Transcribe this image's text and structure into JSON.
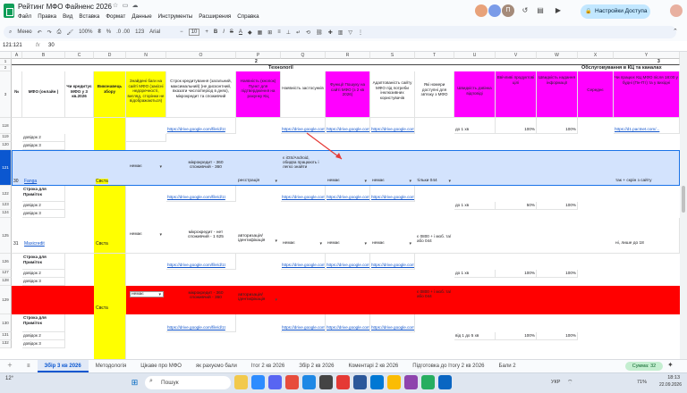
{
  "app": {
    "title": "Рейтинг МФО Файненс 2026",
    "menus": [
      "Файл",
      "Правка",
      "Вид",
      "Вставка",
      "Формат",
      "Данные",
      "Инструменты",
      "Расширения",
      "Справка"
    ],
    "share_label": "Настройки Доступа"
  },
  "toolbar": {
    "search": "Меню",
    "zoom": "100%",
    "currency": "₴",
    "percent": "%",
    "decimals": ".0  .00",
    "num123": "123",
    "font": "Arial",
    "fontsize": "10"
  },
  "formula": {
    "cell_ref": "121:121",
    "fx": "fx",
    "value": "30"
  },
  "grid": {
    "columns": [
      "A",
      "B",
      "C",
      "D",
      "N",
      "O",
      "P",
      "Q",
      "R",
      "S",
      "T",
      "U",
      "V",
      "W",
      "X",
      "Y"
    ],
    "top_rows": [
      "1",
      "2",
      "3"
    ],
    "group_labels": {
      "tech": "Технології",
      "tech_num": "2",
      "service": "Обслуговування в КЦ та каналах",
      "service_num": "3"
    },
    "headers": {
      "num": "№",
      "mfo": "МФО (онлайн )",
      "credit": "Чи кредитує МФО у 3 кв.2026",
      "collector": "Виконавець збору",
      "n": "Знайдені баги на сайті МФО (закісні недоречності, вигляд, сторінки не відображаються)",
      "o": "Строк кредитування (загальний, максимальний) (не дисконтний, вказати число/період в днях), мікрокредит та споживчий",
      "p": "Наявність (кнопок) Пункт для підтвердження на рахунку КЦ",
      "q": "Наявність застосунків",
      "r": "Функції Пошуку на сайті МФО (з 2 кв 2026)",
      "s": "Адаптованість сайту МФО під потреби інклюзивних користувачів",
      "t": "Які номери доступні для зв'язку з МФО",
      "u": "Швидкість дзвінка відповіді",
      "v": "Ввічливі продуктові цілі",
      "w": "Швидкість надання інформації",
      "x": "Середнє",
      "y": "Чи працює КЦ МФО після 18:00 у будні (Пн-Пт) та у вихідні"
    },
    "rows": [
      {
        "n": "118",
        "mfo": "",
        "link": "https://drive.google.com/file/d/1t",
        "status": "",
        "u": "до 1 хв",
        "v": "100%",
        "w": "100%",
        "y": "https://d1.pactnet.com/..."
      },
      {
        "n": "119",
        "mfo": "",
        "a": "довідок 2"
      },
      {
        "n": "120",
        "mfo": "",
        "a": "довідок 3"
      },
      {
        "n": "121",
        "num": "30",
        "mfo": "Fanga",
        "credit": "",
        "col": "Свєта",
        "n_val": "немає",
        "o": "мікрокредит - 360 споживчий - 360",
        "p": "реєстрація",
        "q": "є iOS/Android, обидва працюють і легко знайти",
        "r": "немає",
        "s": "немає",
        "t": "тільки 044",
        "y": "так + скрін з сайту"
      },
      {
        "n": "122",
        "a": "Строка для Приміток"
      },
      {
        "n": "123",
        "a": "довідок 2",
        "u": "до 1 хв",
        "v": "50%",
        "w": "100%"
      },
      {
        "n": "124",
        "a": "довідок 3"
      },
      {
        "n": "125",
        "num": "31",
        "mfo": "Maxicredit",
        "col": "Свєта",
        "n_val": "немає",
        "o": "мікрокредит - нет споживчий - 1 625",
        "p": "авторизація/ідентифікація",
        "q": "немає",
        "r": "немає",
        "s": "немає",
        "t": "є 0800 + і моб. та/або 044",
        "y": "ні, лише до 18"
      },
      {
        "n": "126",
        "a": "Строка для Приміток"
      },
      {
        "n": "127",
        "a": "довідок 2",
        "u": "до 1 хв",
        "v": "100%",
        "w": "100%"
      },
      {
        "n": "128",
        "a": "довідок 3"
      },
      {
        "n": "129",
        "num": "32",
        "mfo": "",
        "col": "Свєта",
        "n_val": "немає",
        "o": "мікрокредит - 360 споживчий - 360",
        "p": "авторизація/ідентифікація",
        "t": "є 0800 + і моб. та/або 044"
      },
      {
        "n": "130",
        "a": "Строка для Приміток"
      },
      {
        "n": "131",
        "a": "довідок 2",
        "u": "від 1 до 5 хв",
        "v": "100%",
        "w": "100%"
      },
      {
        "n": "132",
        "a": "довідок 3"
      }
    ],
    "link_text": "https://drive.google.com/file/d/1t",
    "link_text2": "https://drive.google.com/"
  },
  "tabs": [
    "Збір 3 кв 2026",
    "Методологія",
    "Цікаве про МФО",
    "як рахуємо бали",
    "Ітог 2 кв 2026",
    "Збір 2 кв 2026",
    "Коментарі 2 кв 2026",
    "Підготовка до Ітогу 2 кв 2026",
    "Бали 2"
  ],
  "sum_label": "Сумма: 32",
  "taskbar": {
    "search": "Пошук",
    "lang": "УКР",
    "battery": "71%",
    "time": "18:13",
    "date": "22.09.2026",
    "weather_temp": "12°"
  },
  "colors": {
    "yellow": "#ffff00",
    "red": "#ff0000",
    "magenta": "#ff00ff",
    "selected": "#d3e3fd",
    "green": "#0f9d58"
  }
}
